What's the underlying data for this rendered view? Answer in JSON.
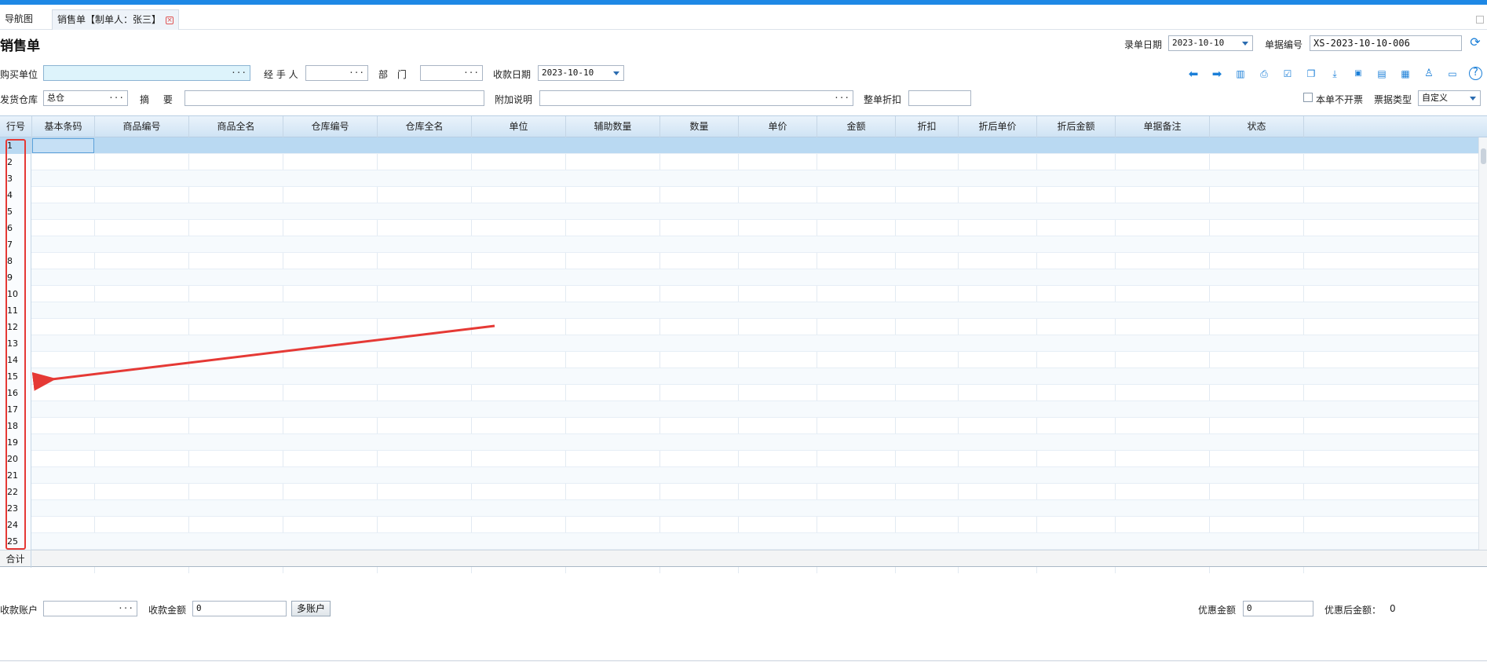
{
  "tabs": {
    "nav": "导航图",
    "active": "销售单【制单人：张三】"
  },
  "page_title": "销售单",
  "header": {
    "entry_date_label": "录单日期",
    "entry_date_value": "2023-10-10",
    "doc_no_label": "单据编号",
    "doc_no_value": "XS-2023-10-10-006"
  },
  "form": {
    "buyer_label": "购买单位",
    "buyer_value": "",
    "handler_label": "经 手 人",
    "handler_value": "",
    "dept_label": "部 门",
    "dept_value": "",
    "pay_date_label": "收款日期",
    "pay_date_value": "2023-10-10",
    "warehouse_label": "发货仓库",
    "warehouse_value": "总仓",
    "summary_label": "摘 要",
    "summary_value": "",
    "extra_note_label": "附加说明",
    "extra_note_value": "",
    "discount_label": "整单折扣",
    "discount_value": "",
    "no_invoice_label": "本单不开票",
    "no_invoice_checked": false,
    "ticket_type_label": "票据类型",
    "ticket_type_value": "自定义"
  },
  "toolbar_icons": [
    "arrow-left-icon",
    "arrow-right-icon",
    "barcode-icon",
    "print-icon",
    "check-icon",
    "copy-icon",
    "import-icon",
    "sql-icon",
    "save-icon",
    "calculator-icon",
    "user-icon",
    "folder-icon",
    "help-icon"
  ],
  "table": {
    "columns": [
      "行号",
      "基本条码",
      "商品编号",
      "商品全名",
      "仓库编号",
      "仓库全名",
      "单位",
      "辅助数量",
      "数量",
      "单价",
      "金额",
      "折扣",
      "折后单价",
      "折后金额",
      "单据备注",
      "状态"
    ],
    "rows": [
      "1",
      "2",
      "3",
      "4",
      "5",
      "6",
      "7",
      "8",
      "9",
      "10",
      "11",
      "12",
      "13",
      "14",
      "15",
      "16",
      "17",
      "18",
      "19",
      "20",
      "21",
      "22",
      "23",
      "24",
      "25"
    ],
    "total_label": "合计"
  },
  "footer": {
    "account_label": "收款账户",
    "account_value": "",
    "amount_label": "收款金额",
    "amount_value": "0",
    "multi_account_button": "多账户",
    "discount_amount_label": "优惠金额",
    "discount_amount_value": "0",
    "after_discount_label": "优惠后金额：",
    "after_discount_value": "0"
  },
  "colors": {
    "accent": "#1e88e5",
    "highlight": "#e53935",
    "selected_row": "#b9d9f2"
  }
}
